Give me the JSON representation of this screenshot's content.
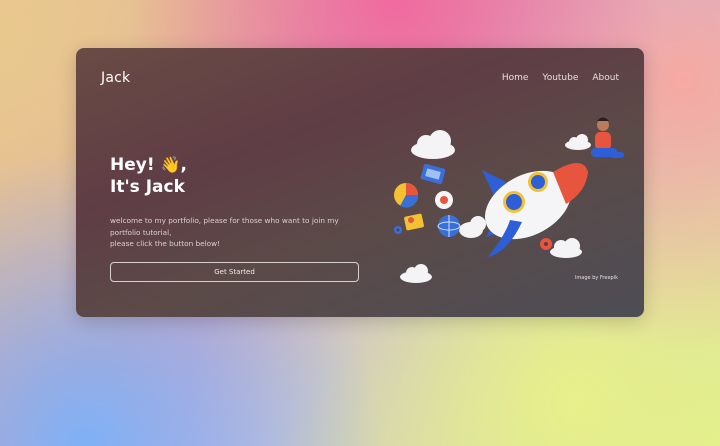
{
  "header": {
    "logo": "Jack",
    "nav": [
      {
        "label": "Home"
      },
      {
        "label": "Youtube"
      },
      {
        "label": "About"
      }
    ]
  },
  "hero": {
    "greeting": "Hey!",
    "wave_emoji": "👋",
    "greeting_suffix": ",",
    "name_line": "It's Jack",
    "description_line1": "welcome to my portfolio, please for those who want to join my",
    "description_line2": "portfolio tutorial,",
    "description_line3": "please click the button below!",
    "button_label": "Get Started"
  },
  "illustration": {
    "credit": "Image by Freepik",
    "icons": [
      "cloud-icon",
      "rocket-icon",
      "person-icon",
      "pie-chart-icon",
      "globe-icon",
      "gear-icon",
      "photo-icon",
      "location-pin-icon"
    ]
  },
  "colors": {
    "card_bg": "#5f3d45",
    "text_primary": "#ffffff",
    "rocket_accent": "#e8553e",
    "rocket_blue": "#2f5fd6"
  }
}
